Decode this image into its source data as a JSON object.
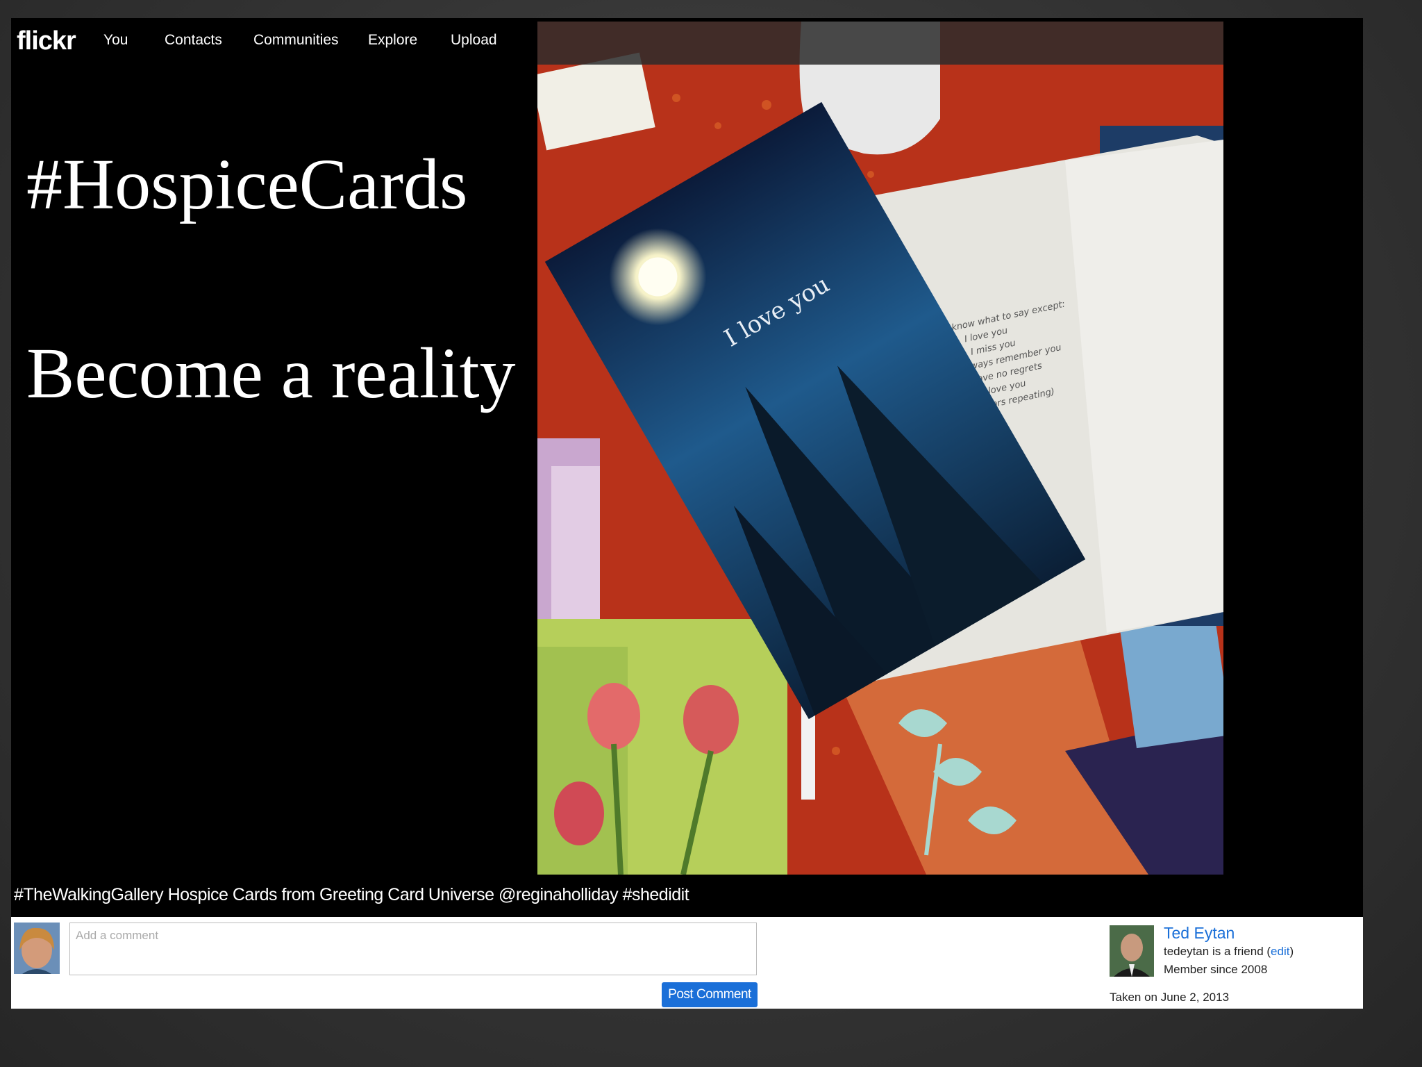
{
  "nav": {
    "logo": "flickr",
    "items": [
      "You",
      "Contacts",
      "Communities",
      "Explore",
      "Upload"
    ]
  },
  "slide": {
    "title": "#HospiceCards",
    "subtitle": "Become a reality"
  },
  "photo": {
    "caption": "#TheWalkingGallery Hospice Cards from Greeting Card Universe @reginaholliday #shedidit",
    "card_front_text": "I love you",
    "card_inside_lines": [
      "I don't know what to say except:",
      "I love you",
      "I miss you",
      "I'll always remember you",
      "I have no regrets",
      "I love you",
      "(it bears repeating)"
    ]
  },
  "comment": {
    "placeholder": "Add a comment",
    "post_label": "Post Comment"
  },
  "owner": {
    "name": "Ted Eytan",
    "friend_text": "tedeytan is a friend (",
    "edit_label": "edit",
    "friend_close": ")",
    "member_since": "Member since 2008",
    "taken_on": "Taken on June 2, 2013"
  },
  "colors": {
    "link": "#1a6fd8",
    "button": "#1a6fd8"
  }
}
